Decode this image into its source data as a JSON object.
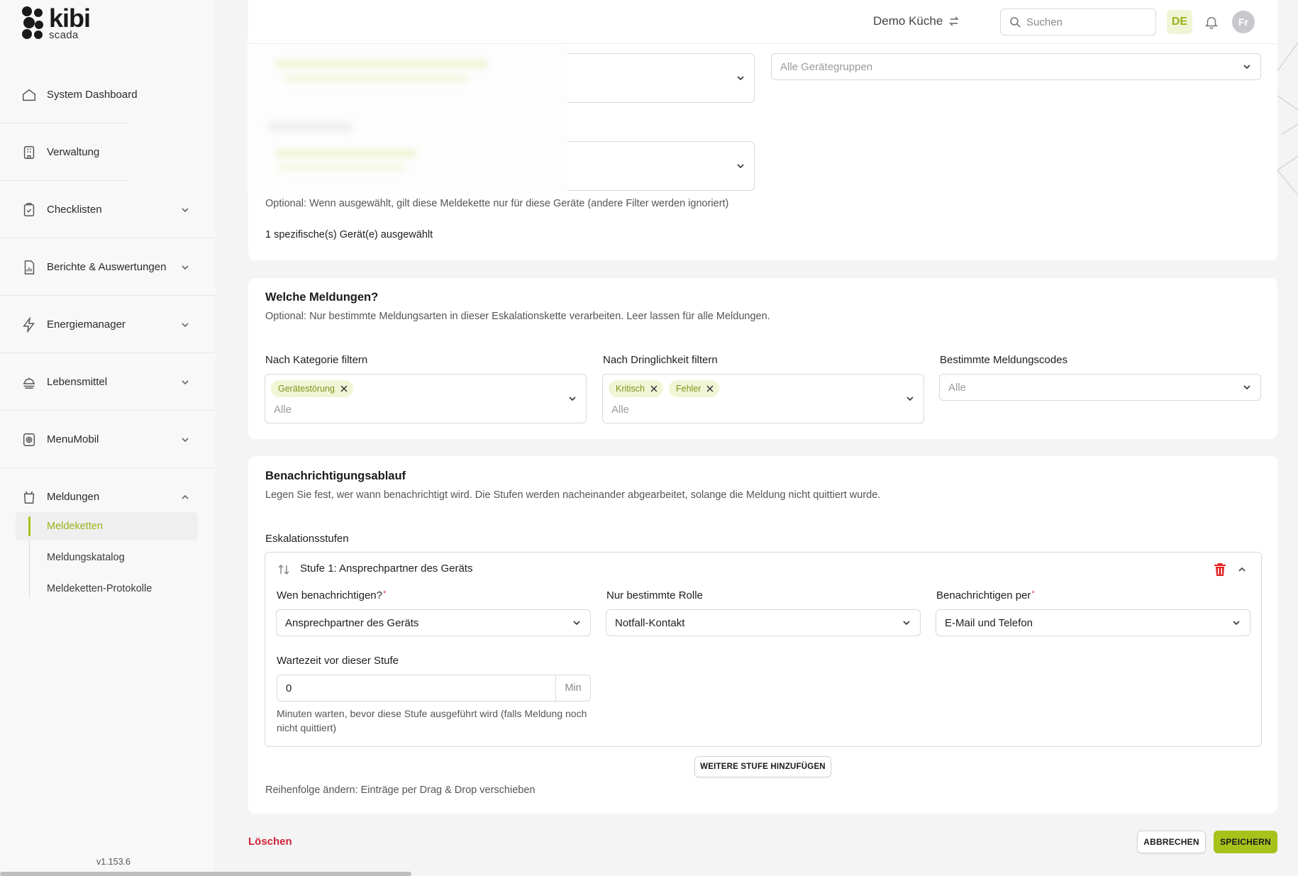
{
  "brand": {
    "name": "kibi",
    "sub": "scada"
  },
  "sidebar": {
    "items": [
      {
        "label": "System Dashboard",
        "icon": "home-icon"
      },
      {
        "label": "Verwaltung",
        "icon": "building-icon"
      },
      {
        "label": "Checklisten",
        "icon": "clipboard-check-icon",
        "expandable": true
      },
      {
        "label": "Berichte & Auswertungen",
        "icon": "report-icon",
        "expandable": true
      },
      {
        "label": "Energiemanager",
        "icon": "bolt-icon",
        "expandable": true
      },
      {
        "label": "Lebensmittel",
        "icon": "food-icon",
        "expandable": true
      },
      {
        "label": "MenuMobil",
        "icon": "camera-icon",
        "expandable": true
      },
      {
        "label": "Meldungen",
        "icon": "apron-icon",
        "expanded": true
      }
    ],
    "subitems": [
      {
        "label": "Meldeketten",
        "active": true
      },
      {
        "label": "Meldungskatalog"
      },
      {
        "label": "Meldeketten-Protokolle"
      }
    ],
    "version": "v1.153.6"
  },
  "header": {
    "tenant": "Demo Küche",
    "search_placeholder": "Suchen",
    "language": "DE",
    "avatar_initials": "Fr"
  },
  "devices": {
    "group_placeholder": "Alle Gerätegruppen",
    "hint": "Optional: Wenn ausgewählt, gilt diese Meldekette nur für diese Geräte (andere Filter werden ignoriert)",
    "selected_count": "1 spezifische(s) Gerät(e) ausgewählt"
  },
  "messages": {
    "title": "Welche Meldungen?",
    "hint": "Optional: Nur bestimmte Meldungsarten in dieser Eskalationskette verarbeiten. Leer lassen für alle Meldungen.",
    "category_label": "Nach Kategorie filtern",
    "category_tags": [
      "Gerätestörung"
    ],
    "category_placeholder": "Alle",
    "urgency_label": "Nach Dringlichkeit filtern",
    "urgency_tags": [
      "Kritisch",
      "Fehler"
    ],
    "urgency_placeholder": "Alle",
    "codes_label": "Bestimmte Meldungscodes",
    "codes_placeholder": "Alle"
  },
  "notification": {
    "title": "Benachrichtigungsablauf",
    "hint": "Legen Sie fest, wer wann benachrichtigt wird. Die Stufen werden nacheinander abgearbeitet, solange die Meldung nicht quittiert wurde.",
    "stages_label": "Eskalationsstufen",
    "stage": {
      "title": "Stufe 1: Ansprechpartner des Geräts",
      "who_label": "Wen benachrichtigen?",
      "who_value": "Ansprechpartner des Geräts",
      "role_label": "Nur bestimmte Rolle",
      "role_value": "Notfall-Kontakt",
      "via_label": "Benachrichtigen per",
      "via_value": "E-Mail und Telefon",
      "wait_label": "Wartezeit vor dieser Stufe",
      "wait_value": "0",
      "wait_unit": "Min",
      "wait_hint": "Minuten warten, bevor diese Stufe ausgeführt wird (falls Meldung noch nicht quittiert)"
    },
    "add_stage_button": "WEITERE STUFE HINZUFÜGEN",
    "reorder_hint": "Reihenfolge ändern: Einträge per Drag & Drop verschieben"
  },
  "footer": {
    "delete_label": "Löschen",
    "cancel_label": "ABBRECHEN",
    "save_label": "SPEICHERN"
  },
  "colors": {
    "accent": "#a6c21b",
    "accent_text": "#98b21c",
    "danger": "#d1243a",
    "tag_bg": "#f1f5d6"
  }
}
